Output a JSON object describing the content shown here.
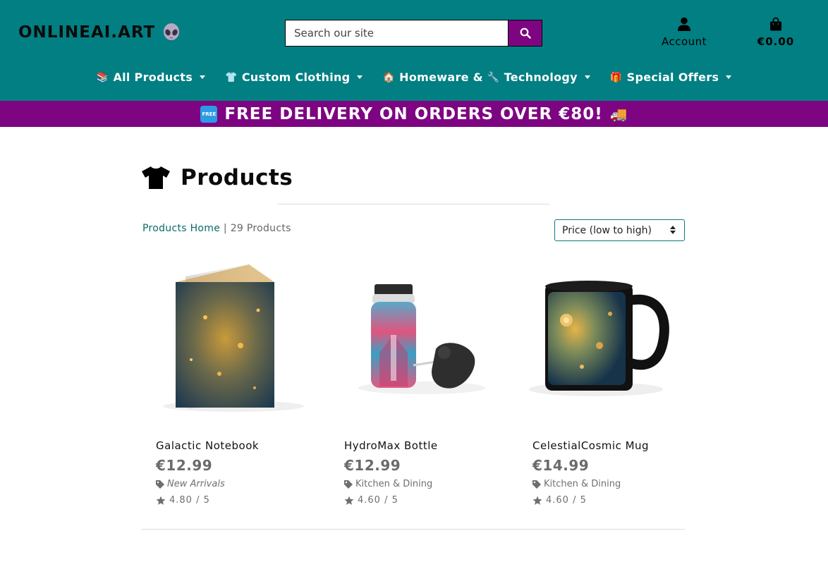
{
  "header": {
    "logo_text": "ONLINEAI.ART",
    "logo_icon": "alien-icon",
    "search_placeholder": "Search our site",
    "account_label": "Account",
    "cart_total": "€0.00"
  },
  "nav": {
    "items": [
      {
        "emoji": "📚",
        "label": "All Products"
      },
      {
        "emoji": "👕",
        "label": "Custom Clothing"
      },
      {
        "emoji": "🏠",
        "label": "Homeware &"
      },
      {
        "emoji": "🔧",
        "label": "Technology"
      },
      {
        "emoji": "🎁",
        "label": "Special Offers"
      }
    ]
  },
  "banner": {
    "badge": "FREE",
    "text": "FREE DELIVERY ON ORDERS OVER €80!",
    "truck_emoji": "🚚"
  },
  "page": {
    "title": "Products",
    "breadcrumb_link": "Products Home",
    "separator": " | ",
    "count_text": "29 Products",
    "sort_selected": "Price (low to high)"
  },
  "products": [
    {
      "name": "Galactic Notebook",
      "price": "€12.99",
      "category": "New Arrivals",
      "rating": "4.80 / 5"
    },
    {
      "name": "HydroMax Bottle",
      "price": "€12.99",
      "category": "Kitchen & Dining",
      "rating": "4.60 / 5"
    },
    {
      "name": "CelestialCosmic Mug",
      "price": "€14.99",
      "category": "Kitchen & Dining",
      "rating": "4.60 / 5"
    }
  ],
  "colors": {
    "header_bg": "#017f82",
    "accent_purple": "#7e0582",
    "link_teal": "#0a6a6c"
  }
}
